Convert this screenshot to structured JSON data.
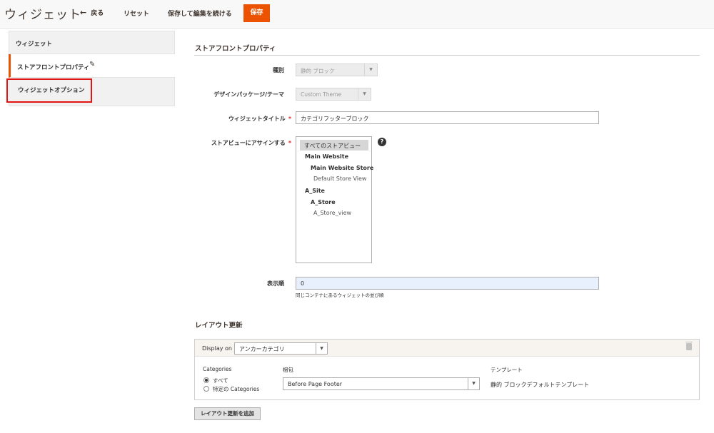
{
  "header": {
    "title": "ウィジェット",
    "back_label": "戻る",
    "reset_label": "リセット",
    "save_continue_label": "保存して編集を続ける",
    "save_label": "保存"
  },
  "sidebar": {
    "heading": "ウィジェット",
    "items": [
      {
        "label": "ストアフロントプロパティ",
        "icon": "pencil-icon"
      },
      {
        "label": "ウィジェットオプション"
      }
    ]
  },
  "storefront": {
    "section_title": "ストアフロントプロパティ",
    "type_label": "種別",
    "type_value": "静的 ブロック",
    "theme_label": "デザインパッケージ/テーマ",
    "theme_value": "Custom Theme",
    "title_label": "ウィジェットタイトル",
    "title_value": "カテゴリフッターブロック",
    "assign_label": "ストアビューにアサインする",
    "store_options": [
      "すべてのストアビュー",
      "Main Website",
      "Main Website Store",
      "Default Store View",
      "A_Site",
      "A_Store",
      "A_Store_view"
    ],
    "help_glyph": "?",
    "sort_label": "表示順",
    "sort_value": "0",
    "sort_note": "同じコンテナにあるウィジェットの並び順"
  },
  "layout": {
    "section_title": "レイアウト更新",
    "display_on_label": "Display on",
    "display_on_value": "アンカーカテゴリ",
    "categories_label": "Categories",
    "radio_all": "すべて",
    "radio_specific": "特定の Categories",
    "container_label": "梱包",
    "container_value": "Before Page Footer",
    "template_label": "テンプレート",
    "template_value": "静的 ブロックデフォルトテンプレート",
    "add_button": "レイアウト更新を追加"
  },
  "colors": {
    "accent": "#eb5202",
    "highlight": "#e31414"
  }
}
